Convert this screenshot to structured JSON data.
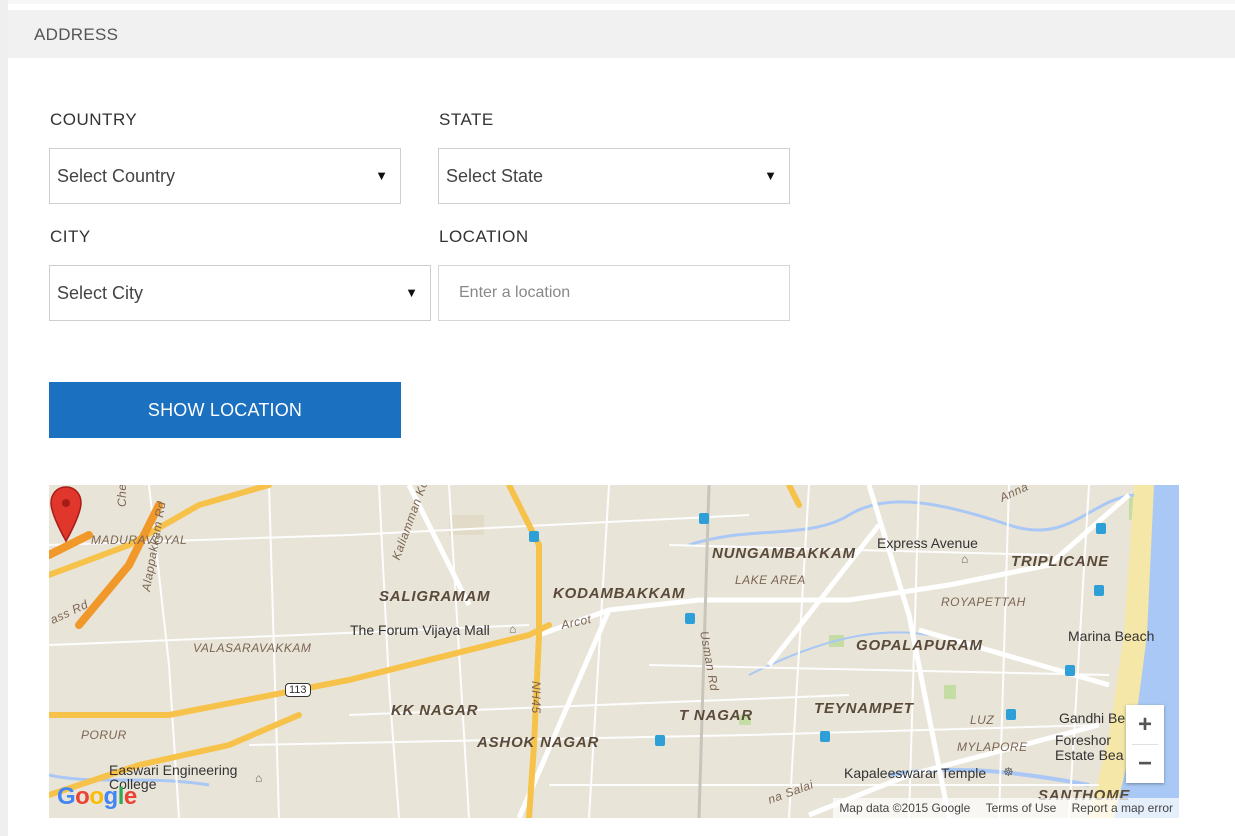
{
  "section": {
    "title": "ADDRESS"
  },
  "form": {
    "country": {
      "label": "COUNTRY",
      "selected": "Select Country"
    },
    "state": {
      "label": "STATE",
      "selected": "Select State"
    },
    "city": {
      "label": "CITY",
      "selected": "Select City"
    },
    "location": {
      "label": "LOCATION",
      "placeholder": "Enter a location"
    },
    "show_button": "SHOW LOCATION"
  },
  "map": {
    "area_labels": [
      "NUNGAMBAKKAM",
      "TRIPLICANE",
      "MADURAVOYAL",
      "SALIGRAMAM",
      "KODAMBAKKAM",
      "GOPALAPURAM",
      "VALASARAVAKKAM",
      "KK NAGAR",
      "T NAGAR",
      "TEYNAMPET",
      "ASHOK NAGAR",
      "PORUR",
      "SANTHOME"
    ],
    "small_labels": [
      "LAKE AREA",
      "ROYAPETTAH",
      "LUZ",
      "MYLAPORE"
    ],
    "road_labels": [
      "Alappakkam Rd",
      "Arcot",
      "Usman Rd",
      "NH45",
      "Kaliamman Ko",
      "Che",
      "ass Rd",
      "Anna",
      "na Salai"
    ],
    "poi_labels": [
      "Express Avenue",
      "The Forum Vijaya Mall",
      "Marina Beach",
      "Gandhi Be",
      "Foreshor Estate Bea",
      "Kapaleeswarar Temple",
      "Easwari Engineering College"
    ],
    "route_shield": "113",
    "zoom_in": "+",
    "zoom_out": "−",
    "logo": "Google",
    "attribution": {
      "data": "Map data ©2015 Google",
      "terms": "Terms of Use",
      "report": "Report a map error"
    }
  },
  "colors": {
    "button": "#1b70c0",
    "header_bg": "#f1f1f1",
    "map_land": "#e9e4d8",
    "map_water": "#a9c8f5",
    "map_road_major": "#f7c24a",
    "map_marker": "#e0362c"
  }
}
